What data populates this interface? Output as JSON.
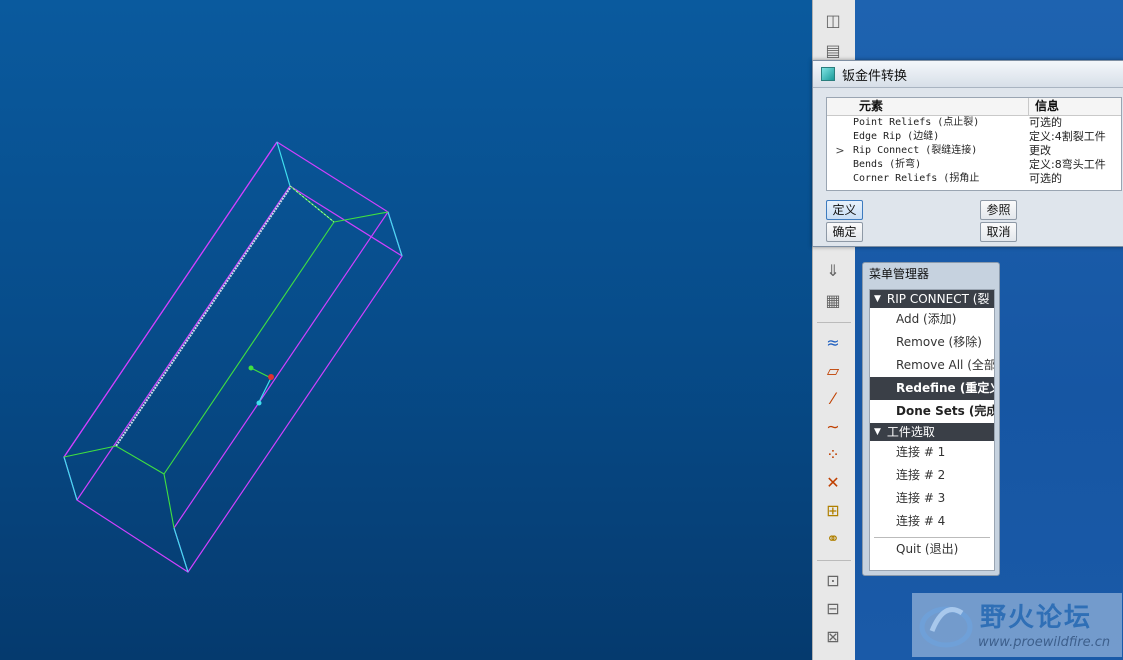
{
  "dialog": {
    "title": "钣金件转换",
    "columns": {
      "element": "元素",
      "info": "信息"
    },
    "rows": [
      {
        "marker": "",
        "name": "Point Reliefs (点止裂)",
        "info": "可选的"
      },
      {
        "marker": "",
        "name": "Edge Rip (边缝)",
        "info": "定义:4割裂工件"
      },
      {
        "marker": ">",
        "name": "Rip Connect (裂缝连接)",
        "info": "更改"
      },
      {
        "marker": "",
        "name": "Bends (折弯)",
        "info": "定义:8弯头工件"
      },
      {
        "marker": "",
        "name": "Corner Reliefs (拐角止",
        "info": "可选的"
      }
    ],
    "buttons": {
      "define": "定义",
      "reference": "参照",
      "ok": "确定",
      "cancel": "取消"
    }
  },
  "menu": {
    "title": "菜单管理器",
    "section1": "RIP CONNECT (裂",
    "items1": [
      "Add (添加)",
      "Remove (移除)",
      "Remove All (全部",
      "Redefine (重定义",
      "Done Sets (完成"
    ],
    "section2": "工件选取",
    "items2": [
      "连接 # 1",
      "连接 # 2",
      "连接 # 3",
      "连接 # 4"
    ],
    "quit": "Quit (退出)"
  },
  "watermark": {
    "title": "野火论坛",
    "url": "www.proewildfire.cn"
  },
  "colors": {
    "viewport": "#0a4f8e",
    "edge_magenta": "#d040ff",
    "edge_cyan": "#40e0f0",
    "edge_green": "#40e040",
    "selected": "#3a3f47"
  }
}
